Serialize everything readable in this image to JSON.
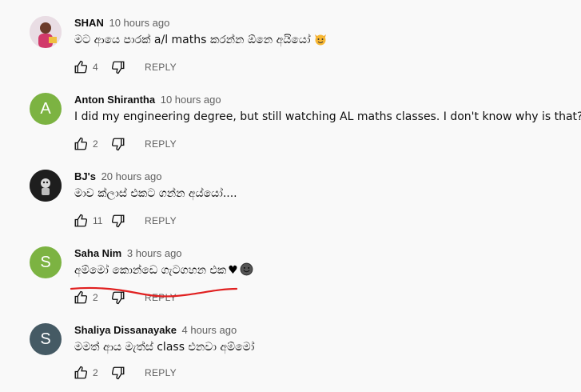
{
  "comments": [
    {
      "author": "SHAN",
      "time": "10 hours ago",
      "text": "මට ආයෙ පාරක් a/l maths කරන්න ඕනෙ අයියෝ",
      "likes": "4",
      "reply": "REPLY",
      "avatar_letter": "",
      "avatar_color": "#e8d7e0"
    },
    {
      "author": "Anton Shirantha",
      "time": "10 hours ago",
      "text": "I did my engineering degree, but still watching AL maths classes. I don't know why is that?",
      "likes": "2",
      "reply": "REPLY",
      "avatar_letter": "A",
      "avatar_color": "#7cb342"
    },
    {
      "author": "BJ's",
      "time": "20 hours ago",
      "text": "මාව ක්ලාස් එකට ගන්න අය්යෝ....",
      "likes": "11",
      "reply": "REPLY",
      "avatar_letter": "",
      "avatar_color": "#222222"
    },
    {
      "author": "Saha Nim",
      "time": "3 hours ago",
      "text": "අම්මෝ කොන්ඩෙ ගැටගහන එක",
      "likes": "2",
      "reply": "REPLY",
      "avatar_letter": "S",
      "avatar_color": "#7cb342"
    },
    {
      "author": "Shaliya Dissanayake",
      "time": "4 hours ago",
      "text": "මමත් ආය මැත්ස් class  එනවා අම්මෝ",
      "likes": "2",
      "reply": "REPLY",
      "avatar_letter": "S",
      "avatar_color": "#455a64"
    }
  ],
  "colors": {
    "annotation": "#e02020",
    "meta": "#606060"
  },
  "icons": {
    "like": "thumbs-up-icon",
    "dislike": "thumbs-down-icon"
  }
}
